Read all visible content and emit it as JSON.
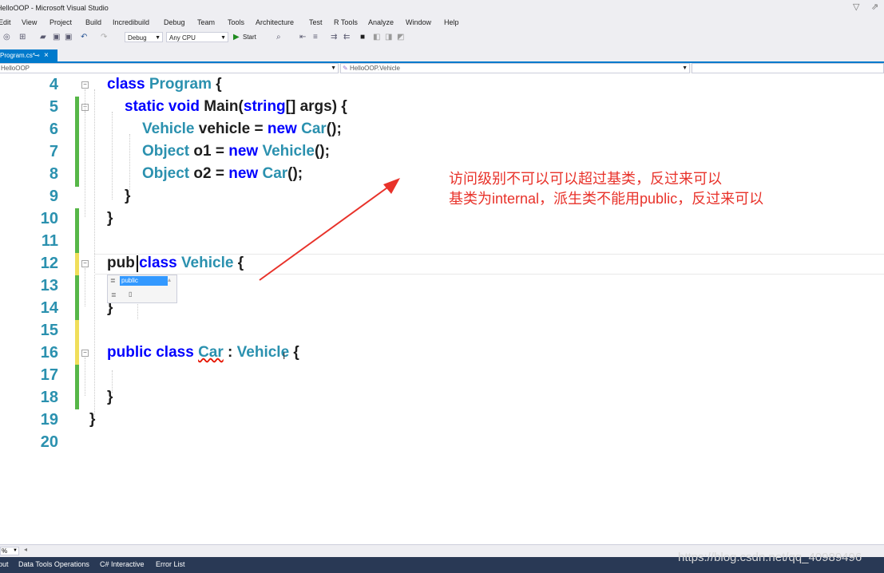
{
  "window": {
    "title": "HelloOOP - Microsoft Visual Studio"
  },
  "menu": [
    "Edit",
    "View",
    "Project",
    "Build",
    "Incredibuild",
    "Debug",
    "Team",
    "Tools",
    "Architecture",
    "Test",
    "R Tools",
    "Analyze",
    "Window",
    "Help"
  ],
  "toolbar": {
    "configuration": "Debug",
    "platform": "Any CPU",
    "start_label": "Start"
  },
  "tabs": {
    "active_label": "Program.cs*"
  },
  "navbar": {
    "project": "HelloOOP",
    "member": "HelloOOP.Vehicle"
  },
  "editor": {
    "line_numbers": [
      "4",
      "5",
      "6",
      "7",
      "8",
      "9",
      "10",
      "11",
      "12",
      "13",
      "14",
      "15",
      "16",
      "17",
      "18",
      "19",
      "20"
    ],
    "lines": {
      "l4": {
        "kw": "class",
        "ty": "Program",
        "rest": " {"
      },
      "l5": {
        "kw1": "static",
        "kw2": "void",
        "name": " Main(",
        "kw3": "string",
        "rest": "[] args) {"
      },
      "l6": {
        "ty": "Vehicle",
        "rest": " vehicle = ",
        "kw": "new",
        "ty2": "Car",
        "end": "();"
      },
      "l7": {
        "ty": "Object",
        "rest": " o1 = ",
        "kw": "new",
        "ty2": "Vehicle",
        "end": "();"
      },
      "l8": {
        "ty": "Object",
        "rest": " o2 = ",
        "kw": "new",
        "ty2": "Car",
        "end": "();"
      },
      "l9": {
        "text": "}"
      },
      "l10": {
        "text": "}"
      },
      "l12": {
        "typed": "pub",
        "kw": "class",
        "ty": "Vehicle",
        "rest": " {"
      },
      "l14": {
        "text": "}"
      },
      "l16": {
        "kw1": "public",
        "kw2": "class",
        "ty": "Car",
        "sep": " : ",
        "ty2": "Vehicle",
        "rest": " {"
      },
      "l18": {
        "text": "}"
      },
      "l19": {
        "text": "}"
      }
    },
    "completion_item": "public"
  },
  "annotation": {
    "line1": "访问级别不可以可以超过基类，反过来可以",
    "line2": "基类为internal，派生类不能用public，反过来可以"
  },
  "status": {
    "zoom": "%"
  },
  "bottom_tabs": [
    "put",
    "Data Tools Operations",
    "C# Interactive",
    "Error List"
  ],
  "watermark": "https://blog.csdn.net/qq_40989496",
  "colors": {
    "keyword": "#0000ff",
    "type": "#2b91af",
    "line_number": "#2b91af",
    "annotation": "#e8322a",
    "accent": "#007acc",
    "change_saved": "#57b748",
    "change_unsaved": "#f0de5a"
  }
}
